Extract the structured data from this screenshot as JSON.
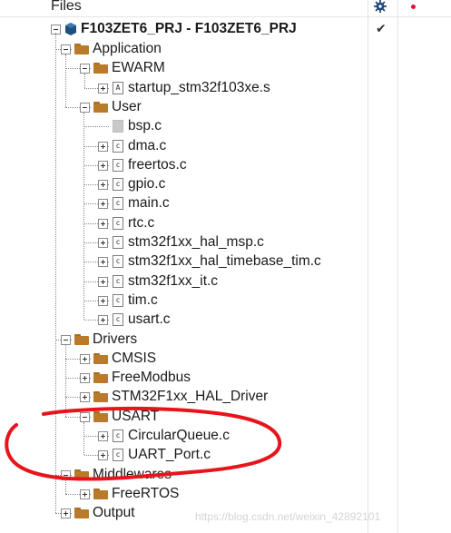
{
  "header": {
    "title": "Files"
  },
  "project": {
    "name": "F103ZET6_PRJ - F103ZET6_PRJ",
    "checkmark": "✔"
  },
  "tree": [
    {
      "label": "Application",
      "type": "folder",
      "expander": "expanded"
    },
    {
      "label": "EWARM",
      "type": "folder",
      "expander": "expanded"
    },
    {
      "label": "startup_stm32f103xe.s",
      "type": "file",
      "icon": "A",
      "expander": "collapsed"
    },
    {
      "label": "User",
      "type": "folder",
      "expander": "expanded"
    },
    {
      "label": "bsp.c",
      "type": "file",
      "icon": "",
      "expander": "none"
    },
    {
      "label": "dma.c",
      "type": "file",
      "icon": "c",
      "expander": "collapsed"
    },
    {
      "label": "freertos.c",
      "type": "file",
      "icon": "c",
      "expander": "collapsed"
    },
    {
      "label": "gpio.c",
      "type": "file",
      "icon": "c",
      "expander": "collapsed"
    },
    {
      "label": "main.c",
      "type": "file",
      "icon": "c",
      "expander": "collapsed"
    },
    {
      "label": "rtc.c",
      "type": "file",
      "icon": "c",
      "expander": "collapsed"
    },
    {
      "label": "stm32f1xx_hal_msp.c",
      "type": "file",
      "icon": "c",
      "expander": "collapsed"
    },
    {
      "label": "stm32f1xx_hal_timebase_tim.c",
      "type": "file",
      "icon": "c",
      "expander": "collapsed"
    },
    {
      "label": "stm32f1xx_it.c",
      "type": "file",
      "icon": "c",
      "expander": "collapsed"
    },
    {
      "label": "tim.c",
      "type": "file",
      "icon": "c",
      "expander": "collapsed"
    },
    {
      "label": "usart.c",
      "type": "file",
      "icon": "c",
      "expander": "collapsed"
    },
    {
      "label": "Drivers",
      "type": "folder",
      "expander": "expanded"
    },
    {
      "label": "CMSIS",
      "type": "folder",
      "expander": "collapsed"
    },
    {
      "label": "FreeModbus",
      "type": "folder",
      "expander": "collapsed"
    },
    {
      "label": "STM32F1xx_HAL_Driver",
      "type": "folder",
      "expander": "collapsed"
    },
    {
      "label": "USART",
      "type": "folder",
      "expander": "expanded"
    },
    {
      "label": "CircularQueue.c",
      "type": "file",
      "icon": "c",
      "expander": "collapsed"
    },
    {
      "label": "UART_Port.c",
      "type": "file",
      "icon": "c",
      "expander": "collapsed"
    },
    {
      "label": "Middlewares",
      "type": "folder",
      "expander": "expanded"
    },
    {
      "label": "FreeRTOS",
      "type": "folder",
      "expander": "collapsed"
    },
    {
      "label": "Output",
      "type": "folder",
      "expander": "collapsed"
    }
  ],
  "icons": {
    "settings": "gear-icon",
    "status": "red-dot-icon"
  },
  "colors": {
    "folder": "#b97a2a",
    "annotation": "#e8141c",
    "watermark": "#d4d4d4"
  },
  "watermark": "https://blog.csdn.net/weixin_42892101"
}
